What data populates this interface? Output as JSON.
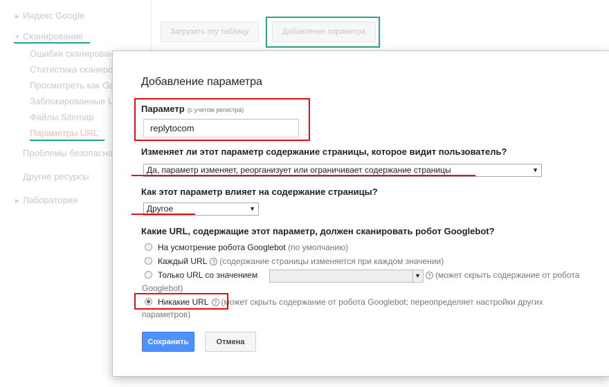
{
  "sidebar": {
    "items": [
      {
        "label": "Индекс Google"
      },
      {
        "label": "Сканирование"
      },
      {
        "label": "Проблемы безопасности"
      },
      {
        "label": "Другие ресурсы"
      },
      {
        "label": "Лаборатория"
      }
    ],
    "subitems": [
      {
        "label": "Ошибки сканирования"
      },
      {
        "label": "Статистика сканирования"
      },
      {
        "label": "Просмотреть как Googlebot"
      },
      {
        "label": "Заблокированные URL"
      },
      {
        "label": "Файлы Sitemap"
      },
      {
        "label": "Параметры URL"
      }
    ]
  },
  "toolbar": {
    "download_label": "Загрузить эту таблицу",
    "add_param_label": "Добавление параметра"
  },
  "dialog": {
    "title": "Добавление параметра",
    "param_label": "Параметр",
    "param_hint": "(с учетом регистра)",
    "param_value": "replytocom",
    "q1": "Изменяет ли этот параметр содержание страницы, которое видит пользователь?",
    "q1_selected": "Да, параметр изменяет, реорганизует или ограничивает содержание страницы",
    "q2": "Как этот параметр влияет на содержание страницы?",
    "q2_selected": "Другое",
    "q3": "Какие URL, содержащие этот параметр, должен сканировать робот Googlebot?",
    "options": [
      {
        "label": "На усмотрение робота Googlebot",
        "note": "(по умолчанию)"
      },
      {
        "label": "Каждый URL",
        "note": "(содержание страницы изменяется при каждом значении)"
      },
      {
        "label": "Только URL со значением",
        "note": "(может скрыть содержание от робота",
        "note_cont": "Googlebot)"
      },
      {
        "label": "Никакие URL",
        "note": "(может скрыть содержание от робота Googlebot; переопределяет настройки других",
        "note_cont": "параметров)"
      }
    ],
    "help_glyph": "?",
    "save_label": "Сохранить",
    "cancel_label": "Отмена"
  },
  "colors": {
    "primary_button": "#4d90fe",
    "annotation_red": "#e01010",
    "annotation_teal": "#25a585"
  }
}
